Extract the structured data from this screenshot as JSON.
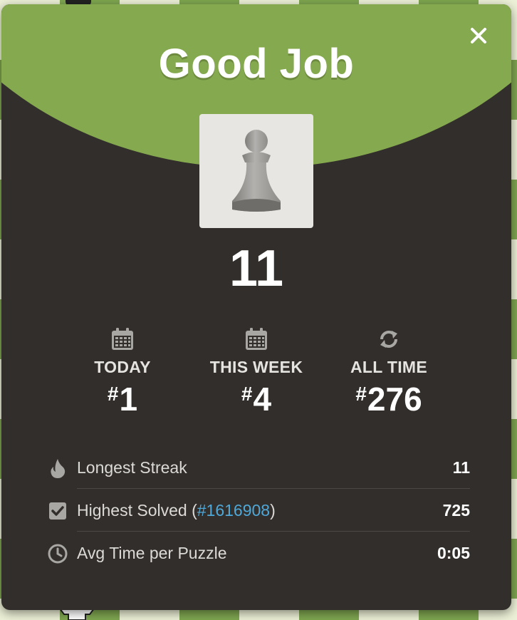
{
  "modal": {
    "title": "Good Job",
    "close_label": "×",
    "score": "11",
    "piece_icon": "pawn-icon"
  },
  "ranks": [
    {
      "label": "TODAY",
      "hash": "#",
      "value": "1",
      "icon": "calendar-icon"
    },
    {
      "label": "THIS WEEK",
      "hash": "#",
      "value": "4",
      "icon": "calendar-icon"
    },
    {
      "label": "ALL TIME",
      "hash": "#",
      "value": "276",
      "icon": "refresh-icon"
    }
  ],
  "stats": {
    "longest_streak": {
      "label": "Longest Streak",
      "value": "11",
      "icon": "flame-icon"
    },
    "highest_solved": {
      "label_prefix": "Highest Solved (",
      "link": "#1616908",
      "label_suffix": ")",
      "value": "725",
      "icon": "checkbox-icon"
    },
    "avg_time": {
      "label": "Avg Time per Puzzle",
      "value": "0:05",
      "icon": "clock-icon"
    }
  },
  "colors": {
    "banner_green": "#85a94e",
    "panel_dark": "#312e2b",
    "link_blue": "#4fa8d8"
  }
}
